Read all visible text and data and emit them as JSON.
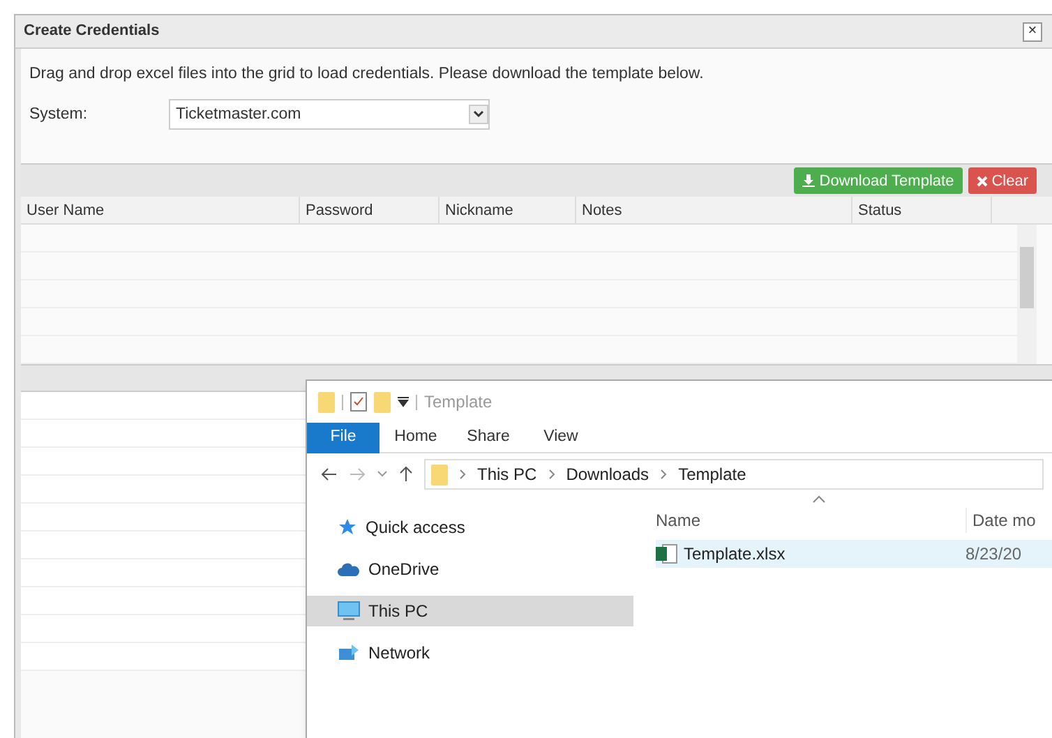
{
  "dialog": {
    "title": "Create Credentials",
    "close": "×",
    "description": "Drag and drop excel files into the grid to load credentials. Please download the template below.",
    "system": {
      "label": "System:",
      "value": "Ticketmaster.com"
    },
    "buttons": [
      {
        "kind": "download",
        "label": "Download Template"
      },
      {
        "kind": "clear",
        "label": "Clear"
      }
    ],
    "columns": [
      "User Name",
      "Password",
      "Nickname",
      "Notes",
      "Status"
    ]
  },
  "explorer": {
    "title": "Template",
    "ribbon_tabs": [
      {
        "label": "File",
        "selected": true
      },
      {
        "label": "Home",
        "selected": false
      },
      {
        "label": "Share",
        "selected": false
      },
      {
        "label": "View",
        "selected": false
      }
    ],
    "breadcrumb": [
      "This PC",
      "Downloads",
      "Template"
    ],
    "nav_items": [
      {
        "kind": "star",
        "label": "Quick access",
        "selected": false
      },
      {
        "kind": "cloud",
        "label": "OneDrive",
        "selected": false
      },
      {
        "kind": "pc",
        "label": "This PC",
        "selected": true
      },
      {
        "kind": "network",
        "label": "Network",
        "selected": false
      }
    ],
    "columns": [
      "Name",
      "Date mo"
    ],
    "files": [
      {
        "name": "Template.xlsx",
        "date": "8/23/20",
        "selected": true
      }
    ]
  }
}
